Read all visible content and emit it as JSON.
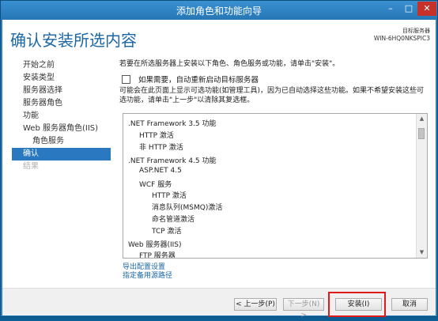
{
  "window": {
    "title": "添加角色和功能向导",
    "min_glyph": "–",
    "max_glyph": "□",
    "close_glyph": "✕"
  },
  "header": {
    "page_title": "确认安装所选内容",
    "dest_label": "目标服务器",
    "dest_server": "WIN-6HQ0NKSPIC3"
  },
  "nav": {
    "items": [
      {
        "label": "开始之前"
      },
      {
        "label": "安装类型"
      },
      {
        "label": "服务器选择"
      },
      {
        "label": "服务器角色"
      },
      {
        "label": "功能"
      },
      {
        "label": "Web 服务器角色(IIS)"
      },
      {
        "label": "角色服务"
      },
      {
        "label": "确认"
      },
      {
        "label": "结果"
      }
    ]
  },
  "content": {
    "intro": "若要在所选服务器上安装以下角色、角色服务或功能，请单击\"安装\"。",
    "restart_label": "如果需要，自动重新启动目标服务器",
    "restart_checked": false,
    "note": "可能会在此页面上显示可选功能(如管理工具)，因为已自动选择这些功能。如果不希望安装这些可选功能，请单击\"上一步\"以清除其复选框。",
    "features": [
      ".NET Framework 3.5 功能",
      "HTTP 激活",
      "非 HTTP 激活",
      ".NET Framework 4.5 功能",
      "ASP.NET 4.5",
      "WCF 服务",
      "HTTP 激活",
      "消息队列(MSMQ)激活",
      "命名管道激活",
      "TCP 激活",
      "Web 服务器(IIS)",
      "FTP 服务器"
    ],
    "export_link": "导出配置设置",
    "alt_source_link": "指定备用源路径"
  },
  "footer": {
    "prev": "< 上一步(P)",
    "next": "下一步(N) >",
    "install": "安装(I)",
    "cancel": "取消"
  },
  "colors": {
    "accent": "#2a78bf",
    "title_text": "#1b67a6",
    "highlight_box": "#e0191a"
  }
}
